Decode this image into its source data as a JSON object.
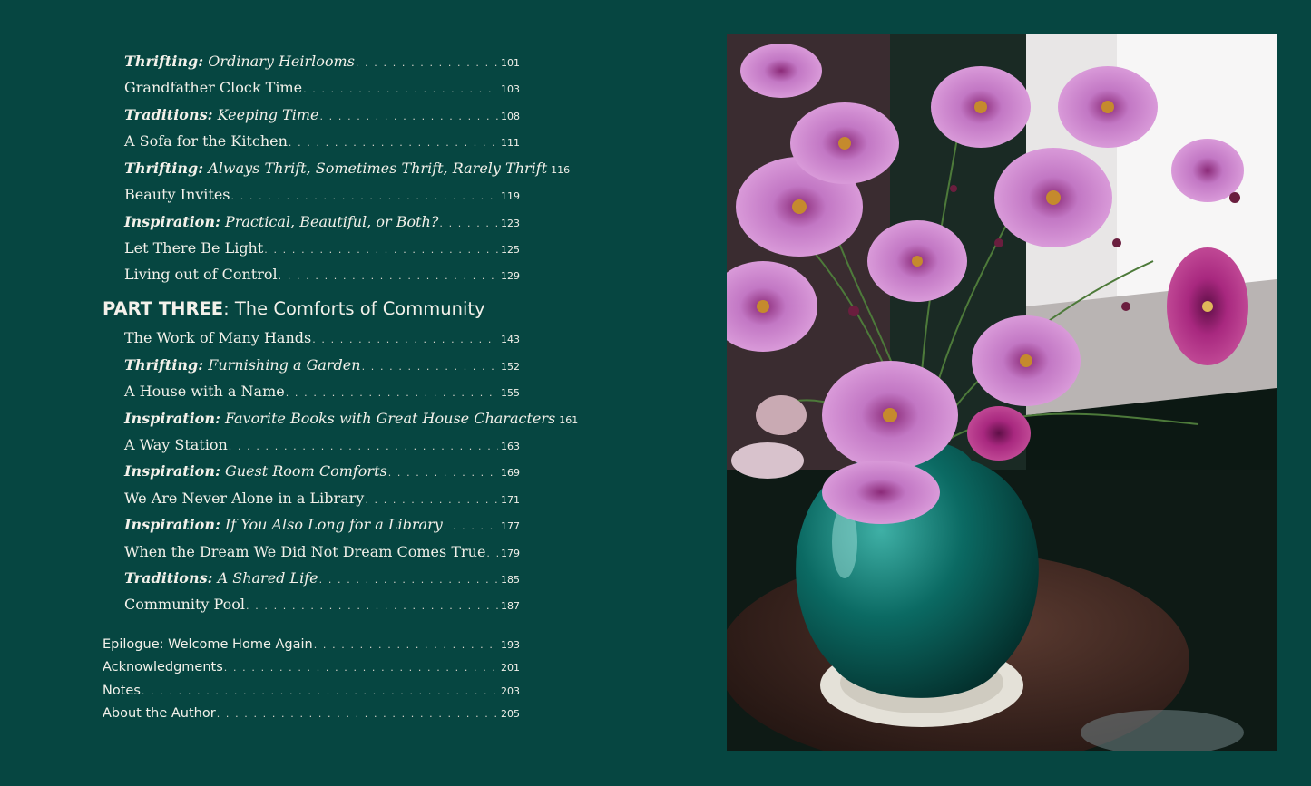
{
  "toc": {
    "part_one_tail": [
      {
        "label": "Thrifting:",
        "title": "Ordinary Heirlooms",
        "page": "101"
      },
      {
        "label": "",
        "title": "Grandfather Clock Time",
        "page": "103"
      },
      {
        "label": "Traditions:",
        "title": "Keeping Time",
        "page": "108"
      },
      {
        "label": "",
        "title": "A Sofa for the Kitchen",
        "page": "111"
      },
      {
        "label": "Thrifting:",
        "title": "Always Thrift, Sometimes Thrift, Rarely Thrift",
        "page": "116"
      },
      {
        "label": "",
        "title": "Beauty Invites",
        "page": "119"
      },
      {
        "label": "Inspiration:",
        "title": "Practical, Beautiful, or Both?",
        "page": "123"
      },
      {
        "label": "",
        "title": "Let There Be Light",
        "page": "125"
      },
      {
        "label": "",
        "title": "Living out of Control",
        "page": "129"
      }
    ],
    "part_three": {
      "label": "PART THREE",
      "title": ": The Comforts of Community"
    },
    "part_three_entries": [
      {
        "label": "",
        "title": "The Work of Many Hands",
        "page": "143"
      },
      {
        "label": "Thrifting:",
        "title": "Furnishing a Garden",
        "page": "152"
      },
      {
        "label": "",
        "title": "A House with a Name",
        "page": "155"
      },
      {
        "label": "Inspiration:",
        "title": "Favorite Books with Great House Characters",
        "page": "161"
      },
      {
        "label": "",
        "title": "A Way Station",
        "page": "163"
      },
      {
        "label": "Inspiration:",
        "title": "Guest Room Comforts",
        "page": "169"
      },
      {
        "label": "",
        "title": "We Are Never Alone in a Library",
        "page": "171"
      },
      {
        "label": "Inspiration:",
        "title": "If You Also Long for a Library",
        "page": "177"
      },
      {
        "label": "",
        "title": "When the Dream We Did Not Dream Comes True",
        "page": "179"
      },
      {
        "label": "Traditions:",
        "title": "A Shared Life",
        "page": "185"
      },
      {
        "label": "",
        "title": "Community Pool",
        "page": "187"
      }
    ],
    "back_matter": [
      {
        "title": "Epilogue: Welcome Home Again",
        "page": "193"
      },
      {
        "title": "Acknowledgments",
        "page": "201"
      },
      {
        "title": "Notes",
        "page": "203"
      },
      {
        "title": "About the Author",
        "page": "205"
      }
    ]
  },
  "colors": {
    "background": "#064641",
    "text": "#f3f1ea",
    "vase": "#0b6a63",
    "flower": "#c77ac4"
  }
}
